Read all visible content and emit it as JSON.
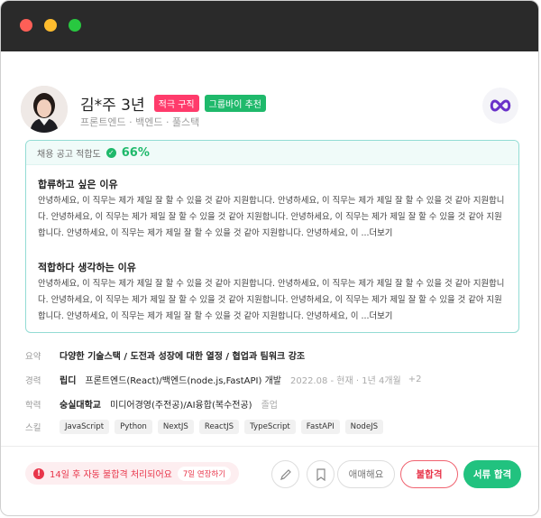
{
  "candidate": {
    "name": "김*주 3년",
    "badges": [
      "적극 구직",
      "그룹바이 추천"
    ],
    "roles": "프론트엔드 · 백엔드 · 풀스택"
  },
  "fit": {
    "label": "채용 공고 적합도",
    "score": "66%"
  },
  "sections": [
    {
      "title": "합류하고 싶은 이유",
      "body": "안녕하세요, 이 직무는 제가 제일 잘 할 수 있을 것 같아 지원합니다. 안녕하세요, 이 직무는 제가 제일 잘 할 수 있을 것 같아 지원합니다. 안녕하세요, 이 직무는 제가 제일 잘 할 수 있을 것 같아 지원합니다. 안녕하세요, 이 직무는 제가 제일 잘 할 수 있을 것 같아 지원합니다. 안녕하세요, 이 직무는 제가 제일 잘 할 수 있을 것 같아 지원합니다. 안녕하세요, 이 ...",
      "more": "더보기"
    },
    {
      "title": "적합하다 생각하는 이유",
      "body": "안녕하세요, 이 직무는 제가 제일 잘 할 수 있을 것 같아 지원합니다. 안녕하세요, 이 직무는 제가 제일 잘 할 수 있을 것 같아 지원합니다. 안녕하세요, 이 직무는 제가 제일 잘 할 수 있을 것 같아 지원합니다. 안녕하세요, 이 직무는 제가 제일 잘 할 수 있을 것 같아 지원합니다. 안녕하세요, 이 직무는 제가 제일 잘 할 수 있을 것 같아 지원합니다. 안녕하세요, 이 ...",
      "more": "더보기"
    }
  ],
  "summary": {
    "label": "요약",
    "value": "다양한 기술스택 / 도전과 성장에 대한 열정 / 협업과 팀워크 강조"
  },
  "career": {
    "label": "경력",
    "company": "립디",
    "position": "프론트엔드(React)/백엔드(node.js,FastAPI) 개발",
    "period": "2022.08 - 현재 · 1년 4개월",
    "extra": "+2"
  },
  "education": {
    "label": "학력",
    "school": "숭실대학교",
    "major": "미디어경영(주전공)/AI융합(복수전공)",
    "status": "졸업"
  },
  "skills": {
    "label": "스킬",
    "items": [
      "JavaScript",
      "Python",
      "NextJS",
      "ReactJS",
      "TypeScript",
      "FastAPI",
      "NodeJS"
    ]
  },
  "footer": {
    "warning": "14일 후 자동 불합격 처리되어요",
    "extend": "7일 연장하기",
    "hold": "애매해요",
    "fail": "불합격",
    "pass": "서류 합격"
  }
}
